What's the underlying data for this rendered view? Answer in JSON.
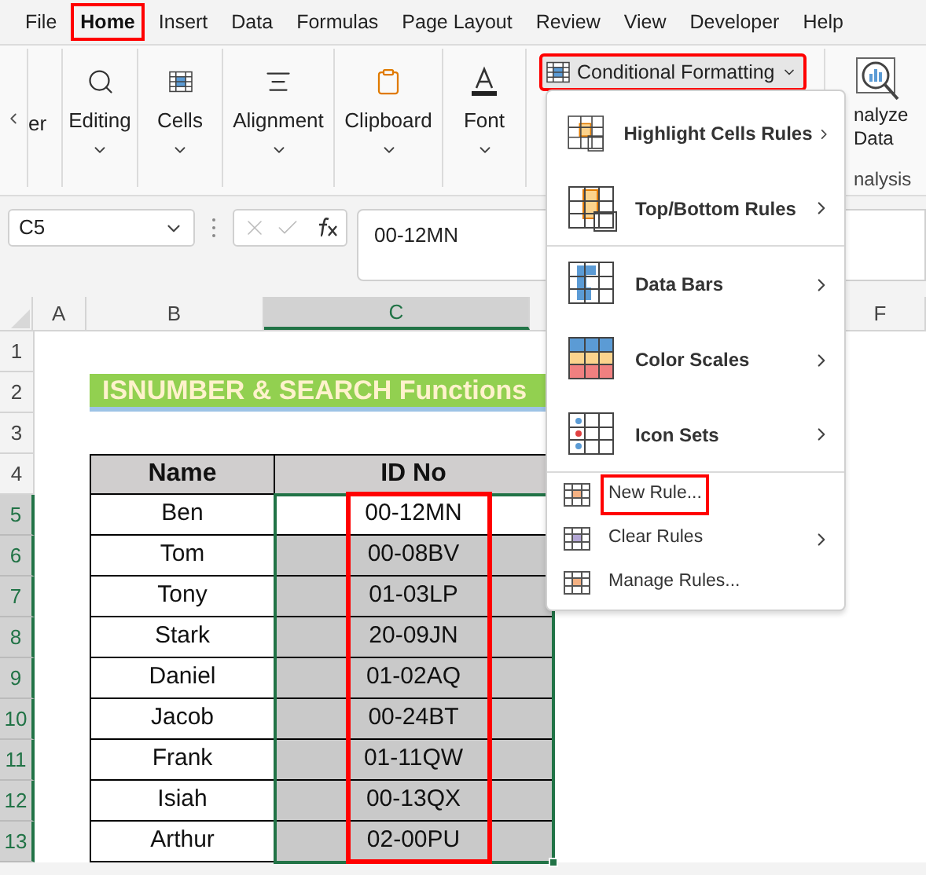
{
  "menu_tabs": [
    {
      "label": "File",
      "selected": false,
      "annotated": false
    },
    {
      "label": "Home",
      "selected": true,
      "annotated": true
    },
    {
      "label": "Insert",
      "selected": false,
      "annotated": false
    },
    {
      "label": "Data",
      "selected": false,
      "annotated": false
    },
    {
      "label": "Formulas",
      "selected": false,
      "annotated": false
    },
    {
      "label": "Page Layout",
      "selected": false,
      "annotated": false
    },
    {
      "label": "Review",
      "selected": false,
      "annotated": false
    },
    {
      "label": "View",
      "selected": false,
      "annotated": false
    },
    {
      "label": "Developer",
      "selected": false,
      "annotated": false
    },
    {
      "label": "Help",
      "selected": false,
      "annotated": false
    }
  ],
  "ribbon": {
    "cut_group": "er",
    "groups": [
      "Editing",
      "Cells",
      "Alignment",
      "Clipboard",
      "Font"
    ],
    "conditional_formatting": {
      "label": "Conditional Formatting",
      "annotated": true
    },
    "analyze": {
      "line_1": "nalyze",
      "line_2": "Data",
      "group": "nalysis"
    }
  },
  "formula_bar": {
    "name_box": "C5",
    "formula": "00-12MN"
  },
  "column_headers": [
    {
      "label": "A",
      "selected": false
    },
    {
      "label": "B",
      "selected": false
    },
    {
      "label": "C",
      "selected": true
    },
    {
      "label": "F",
      "selected": false
    }
  ],
  "row_headers": [
    {
      "label": "1",
      "selected": false
    },
    {
      "label": "2",
      "selected": false
    },
    {
      "label": "3",
      "selected": false
    },
    {
      "label": "4",
      "selected": false
    },
    {
      "label": "5",
      "selected": true
    },
    {
      "label": "6",
      "selected": true
    },
    {
      "label": "7",
      "selected": true
    },
    {
      "label": "8",
      "selected": true
    },
    {
      "label": "9",
      "selected": true
    },
    {
      "label": "10",
      "selected": true
    },
    {
      "label": "11",
      "selected": true
    },
    {
      "label": "12",
      "selected": true
    },
    {
      "label": "13",
      "selected": true
    }
  ],
  "title": "ISNUMBER & SEARCH Functions",
  "table": {
    "columns": [
      "Name",
      "ID No"
    ],
    "id_column_annotated": true,
    "rows": [
      {
        "name": "Ben",
        "id": "00-12MN",
        "active": true
      },
      {
        "name": "Tom",
        "id": "00-08BV",
        "active": false
      },
      {
        "name": "Tony",
        "id": "01-03LP",
        "active": false
      },
      {
        "name": "Stark",
        "id": "20-09JN",
        "active": false
      },
      {
        "name": "Daniel",
        "id": "01-02AQ",
        "active": false
      },
      {
        "name": "Jacob",
        "id": "00-24BT",
        "active": false
      },
      {
        "name": "Frank",
        "id": "01-11QW",
        "active": false
      },
      {
        "name": "Isiah",
        "id": "00-13QX",
        "active": false
      },
      {
        "name": "Arthur",
        "id": "02-00PU",
        "active": false
      }
    ]
  },
  "dropdown": [
    {
      "label": "Highlight Cells Rules",
      "kind": "large",
      "submenu": true,
      "annotated": false,
      "divider_after": false
    },
    {
      "label": "Top/Bottom Rules",
      "kind": "large",
      "submenu": true,
      "annotated": false,
      "divider_after": true
    },
    {
      "label": "Data Bars",
      "kind": "large",
      "submenu": true,
      "annotated": false,
      "divider_after": false
    },
    {
      "label": "Color Scales",
      "kind": "large",
      "submenu": true,
      "annotated": false,
      "divider_after": false
    },
    {
      "label": "Icon Sets",
      "kind": "large",
      "submenu": true,
      "annotated": false,
      "divider_after": true
    },
    {
      "label": "New Rule...",
      "kind": "small",
      "submenu": false,
      "annotated": true,
      "divider_after": false
    },
    {
      "label": "Clear Rules",
      "kind": "small",
      "submenu": true,
      "annotated": false,
      "divider_after": false
    },
    {
      "label": "Manage Rules...",
      "kind": "small",
      "submenu": false,
      "annotated": false,
      "divider_after": false
    }
  ]
}
